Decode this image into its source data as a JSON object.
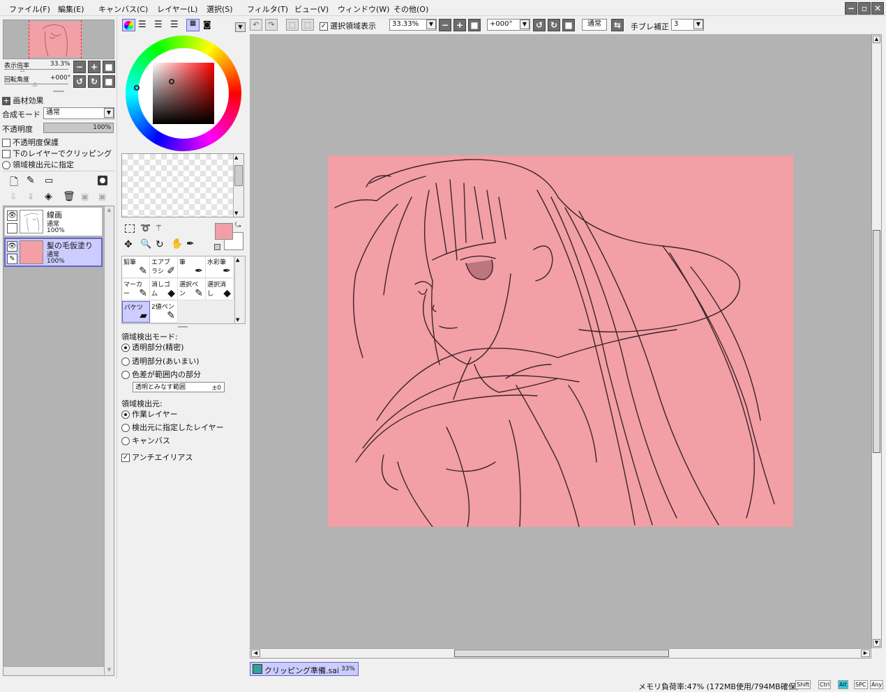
{
  "menu": [
    "ファイル(F)",
    "編集(E)",
    "キャンバス(C)",
    "レイヤー(L)",
    "選択(S)",
    "フィルタ(T)",
    "ビュー(V)",
    "ウィンドウ(W)",
    "その他(O)"
  ],
  "navigator": {
    "zoom_label": "表示倍率",
    "zoom_value": "33.3%",
    "angle_label": "回転角度",
    "angle_value": "+000°"
  },
  "layer_props": {
    "texture_effect": "画材効果",
    "blend_label": "合成モード",
    "blend_value": "通常",
    "opacity_label": "不透明度",
    "opacity_value": "100%",
    "opacity_fraction": 1.0,
    "protect_opacity": "不透明度保護",
    "clip_to_lower": "下のレイヤーでクリッピング",
    "set_as_source": "領域検出元に指定"
  },
  "layers": [
    {
      "name": "線画",
      "mode": "通常",
      "opacity": "100%",
      "selected": false
    },
    {
      "name": "髪の毛仮塗り",
      "mode": "通常",
      "opacity": "100%",
      "selected": true
    }
  ],
  "colors": {
    "foreground": "#f2a0a8",
    "background": "#ffffff",
    "canvas_fill": "#f29fa6",
    "accent": "#ccccff",
    "workspace": "#b3b3b3"
  },
  "tools": [
    {
      "label": "鉛筆",
      "icon": "pencil-icon",
      "glyph": "✎"
    },
    {
      "label": "エアブラシ",
      "icon": "airbrush-icon",
      "glyph": "✐"
    },
    {
      "label": "筆",
      "icon": "brush-icon",
      "glyph": "✒"
    },
    {
      "label": "水彩筆",
      "icon": "watercolor-icon",
      "glyph": "✒"
    },
    {
      "label": "マーカー",
      "icon": "marker-icon",
      "glyph": "✎"
    },
    {
      "label": "消しゴム",
      "icon": "eraser-icon",
      "glyph": "◆"
    },
    {
      "label": "選択ペン",
      "icon": "select-pen-icon",
      "glyph": "✎"
    },
    {
      "label": "選択消し",
      "icon": "select-erase-icon",
      "glyph": "◆"
    },
    {
      "label": "バケツ",
      "icon": "bucket-icon",
      "glyph": "▰"
    },
    {
      "label": "2値ペン",
      "icon": "binary-pen-icon",
      "glyph": "✎"
    }
  ],
  "selected_tool": "バケツ",
  "fill_options": {
    "mode_heading": "領域検出モード:",
    "mode_options": [
      "透明部分(精密)",
      "透明部分(あいまい)",
      "色差が範囲内の部分"
    ],
    "mode_selected": 0,
    "tolerance_label": "透明とみなす範囲",
    "tolerance_value": "±0",
    "source_heading": "領域検出元:",
    "source_options": [
      "作業レイヤー",
      "検出元に指定したレイヤー",
      "キャンバス"
    ],
    "source_selected": 0,
    "antialias": "アンチエイリアス"
  },
  "toolbar": {
    "show_selection": "選択領域表示",
    "zoom": "33.33%",
    "rotation": "+000°",
    "blend": "通常",
    "stabilizer_label": "手ブレ補正",
    "stabilizer_value": "3"
  },
  "document_tab": {
    "name": "クリッピング準備.sai",
    "zoom": "33%"
  },
  "status": {
    "memory": "メモリ負荷率:47% (172MB使用/794MB確保)",
    "keys": [
      "Shift",
      "Ctrl",
      "Alt",
      "SPC",
      "Any"
    ],
    "active_key": "Alt"
  }
}
